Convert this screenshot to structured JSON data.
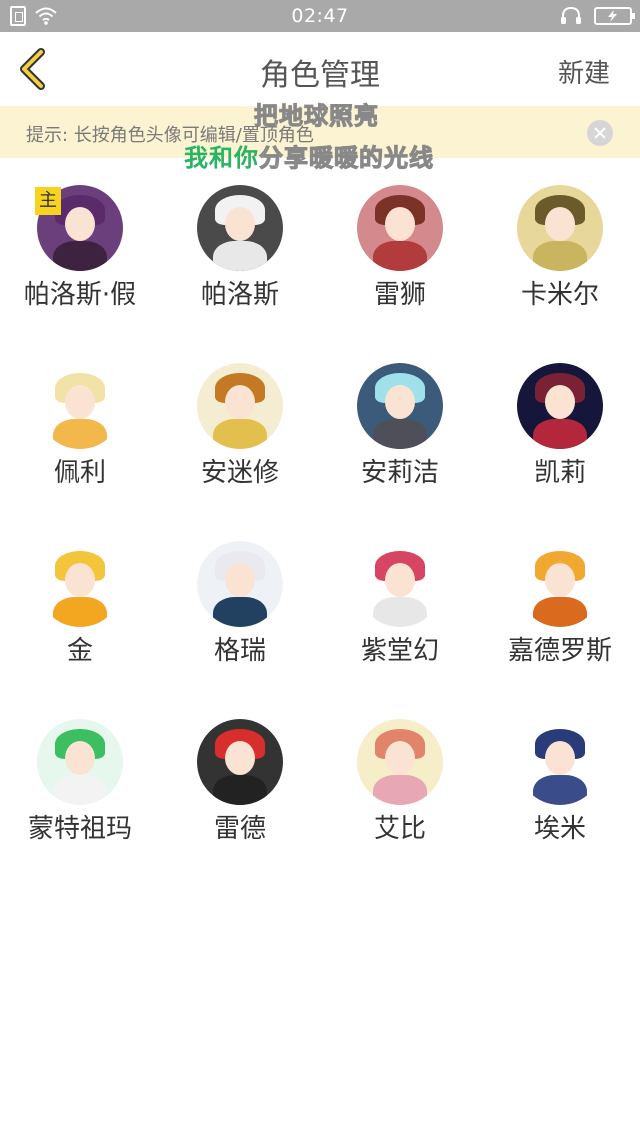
{
  "status_bar": {
    "time": "02:47"
  },
  "nav": {
    "title": "角色管理",
    "new_label": "新建"
  },
  "tip": {
    "text": "提示: 长按角色头像可编辑/置顶角色"
  },
  "overlay": {
    "line1": "把地球照亮",
    "line2_green": "我和你",
    "line2_white": "分享暖暖的光线"
  },
  "main_badge": "主",
  "characters": [
    {
      "name": "帕洛斯·假",
      "hair": "#5a2a6a",
      "bg": "#6b3f7c",
      "body": "#3d2340"
    },
    {
      "name": "帕洛斯",
      "hair": "#f2f2f2",
      "bg": "#4a4a4a",
      "body": "#e8e8e8"
    },
    {
      "name": "雷狮",
      "hair": "#7a3326",
      "bg": "#d48a8c",
      "body": "#b23b3b"
    },
    {
      "name": "卡米尔",
      "hair": "#6b5a2a",
      "bg": "#e7d79a",
      "body": "#c9b45f"
    },
    {
      "name": "佩利",
      "hair": "#f1e3a7",
      "bg": "#ffffff",
      "body": "#f2b84b"
    },
    {
      "name": "安迷修",
      "hair": "#c47a24",
      "bg": "#f5edd2",
      "body": "#e3c04e"
    },
    {
      "name": "安莉洁",
      "hair": "#9fe0ea",
      "bg": "#3c5a7a",
      "body": "#4f4f5a"
    },
    {
      "name": "凯莉",
      "hair": "#7a2235",
      "bg": "#15163a",
      "body": "#b3263c"
    },
    {
      "name": "金",
      "hair": "#f2c53b",
      "bg": "#ffffff",
      "body": "#f3a721"
    },
    {
      "name": "格瑞",
      "hair": "#e9e9ef",
      "bg": "#eef2f7",
      "body": "#22405f"
    },
    {
      "name": "紫堂幻",
      "hair": "#d64562",
      "bg": "#ffffff",
      "body": "#e7e7e7"
    },
    {
      "name": "嘉德罗斯",
      "hair": "#f0a830",
      "bg": "#ffffff",
      "body": "#d96a1e"
    },
    {
      "name": "蒙特祖玛",
      "hair": "#3bbf62",
      "bg": "#e6f7ee",
      "body": "#f3f3f3"
    },
    {
      "name": "雷德",
      "hair": "#d92e2e",
      "bg": "#333333",
      "body": "#222222"
    },
    {
      "name": "艾比",
      "hair": "#e0856a",
      "bg": "#f6eec8",
      "body": "#e8a7b5"
    },
    {
      "name": "埃米",
      "hair": "#2a3b7a",
      "bg": "#ffffff",
      "body": "#3a4d8a"
    }
  ]
}
